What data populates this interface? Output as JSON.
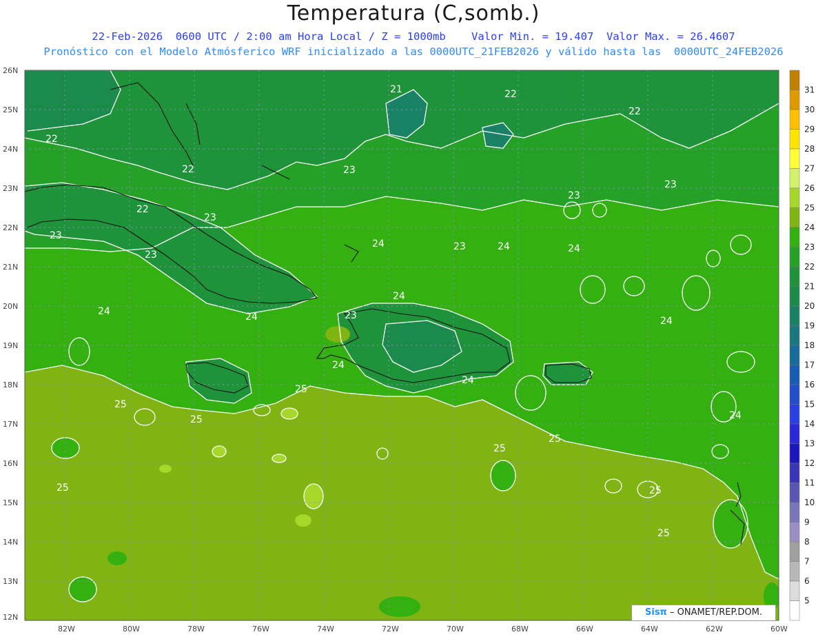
{
  "title": "Temperatura (C,somb.)",
  "subtitle_line1": "22-Feb-2026  0600 UTC / 2:00 am Hora Local / Z = 1000mb    Valor Min. = 19.407  Valor Max. = 26.4607",
  "subtitle_line2": "Pronóstico con el Modelo Atmósferico WRF inicializado a las 0000UTC_21FEB2026 y válido hasta las  0000UTC_24FEB2026",
  "credit": {
    "brand": "Sisπ",
    "text": " – ONAMET/REP.DOM."
  },
  "lat_labels": [
    "26N",
    "25N",
    "24N",
    "23N",
    "22N",
    "21N",
    "20N",
    "19N",
    "18N",
    "17N",
    "16N",
    "15N",
    "14N",
    "13N",
    "12N"
  ],
  "lon_labels": [
    "82W",
    "80W",
    "78W",
    "76W",
    "74W",
    "72W",
    "70W",
    "68W",
    "66W",
    "64W",
    "62W",
    "60W"
  ],
  "colorbar": {
    "labels": [
      "31",
      "30",
      "29",
      "28",
      "27",
      "26",
      "25",
      "24",
      "23",
      "22",
      "21",
      "20",
      "19",
      "18",
      "17",
      "16",
      "15",
      "14",
      "13",
      "12",
      "11",
      "10",
      "9",
      "8",
      "7",
      "6",
      "5"
    ],
    "colors": [
      "#c08000",
      "#e09a00",
      "#ffbf00",
      "#ffe400",
      "#ffff33",
      "#d4f26a",
      "#a6d82a",
      "#80b412",
      "#34b010",
      "#26a128",
      "#1f933a",
      "#1c8a4a",
      "#1a8264",
      "#18787e",
      "#166c9a",
      "#155eb3",
      "#1f50c8",
      "#2a40e0",
      "#2a2ad8",
      "#1c16c0",
      "#3a36b8",
      "#5a56b4",
      "#7a76bc",
      "#9a8ec4",
      "#a0a0a0",
      "#b8b8b8",
      "#dcdcdc",
      "#ffffff"
    ]
  },
  "contour_labels": [
    "21",
    "22",
    "22",
    "22",
    "22",
    "22",
    "23",
    "23",
    "23",
    "23",
    "23",
    "23",
    "23",
    "23",
    "24",
    "24",
    "24",
    "24",
    "24",
    "24",
    "24",
    "24",
    "24",
    "24",
    "25",
    "25",
    "25",
    "25",
    "25",
    "25",
    "25",
    "25"
  ],
  "colors": {
    "band_22": "#1f933a",
    "band_23": "#26a128",
    "band_24": "#34b010",
    "band_25": "#80b412",
    "band_26": "#a6d82a",
    "band_21": "#1c8a4a",
    "grid": "#8c8cc8"
  }
}
